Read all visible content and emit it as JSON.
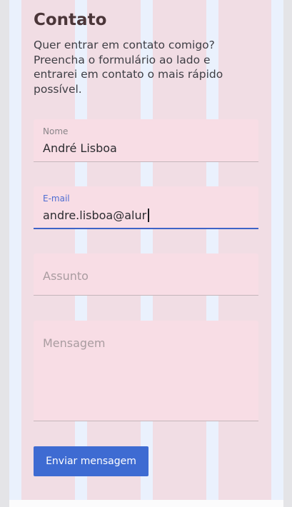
{
  "contact": {
    "title": "Contato",
    "intro": "Quer entrar em contato comigo? Preencha o formulário ao lado e entrarei em contato o mais rápido possível."
  },
  "form": {
    "name": {
      "label": "Nome",
      "value": "André Lisboa"
    },
    "email": {
      "label": "E-mail",
      "value": "andre.lisboa@alur"
    },
    "subject": {
      "placeholder": "Assunto"
    },
    "message": {
      "placeholder": "Mensagem"
    },
    "submit_label": "Enviar mensagem"
  },
  "colors": {
    "accent": "#3e6bd2",
    "title": "#4b3639",
    "field_background": "#f8dde5"
  }
}
